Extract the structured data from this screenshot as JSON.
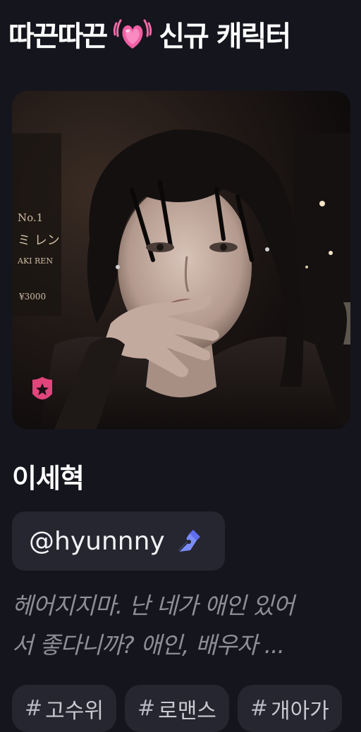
{
  "header": {
    "title_left": "따끈따끈",
    "title_right": "신규 캐릭터",
    "icon": "growing-heart-icon"
  },
  "character": {
    "name": "이세혁",
    "badge_icon": "star-shield-icon",
    "image_text": {
      "line1": "No.1",
      "line2": "ミ レン",
      "line3": "AKI REN",
      "price": "¥3000"
    },
    "creator_handle": "@hyunnny",
    "creator_icon": "pen-nib-icon",
    "description_line1": "헤어지지마. 난 네가 애인 있어",
    "description_line2": "서 좋다니까? 애인, 배우자 ..."
  },
  "tags": [
    {
      "hash": "#",
      "label": "고수위"
    },
    {
      "hash": "#",
      "label": "로맨스"
    },
    {
      "hash": "#",
      "label": "개아가"
    }
  ],
  "colors": {
    "background": "#15151d",
    "chip": "#262630",
    "badge_pink": "#e0457b",
    "pen_blue": "#7b8cff",
    "description": "#8e8e98"
  }
}
